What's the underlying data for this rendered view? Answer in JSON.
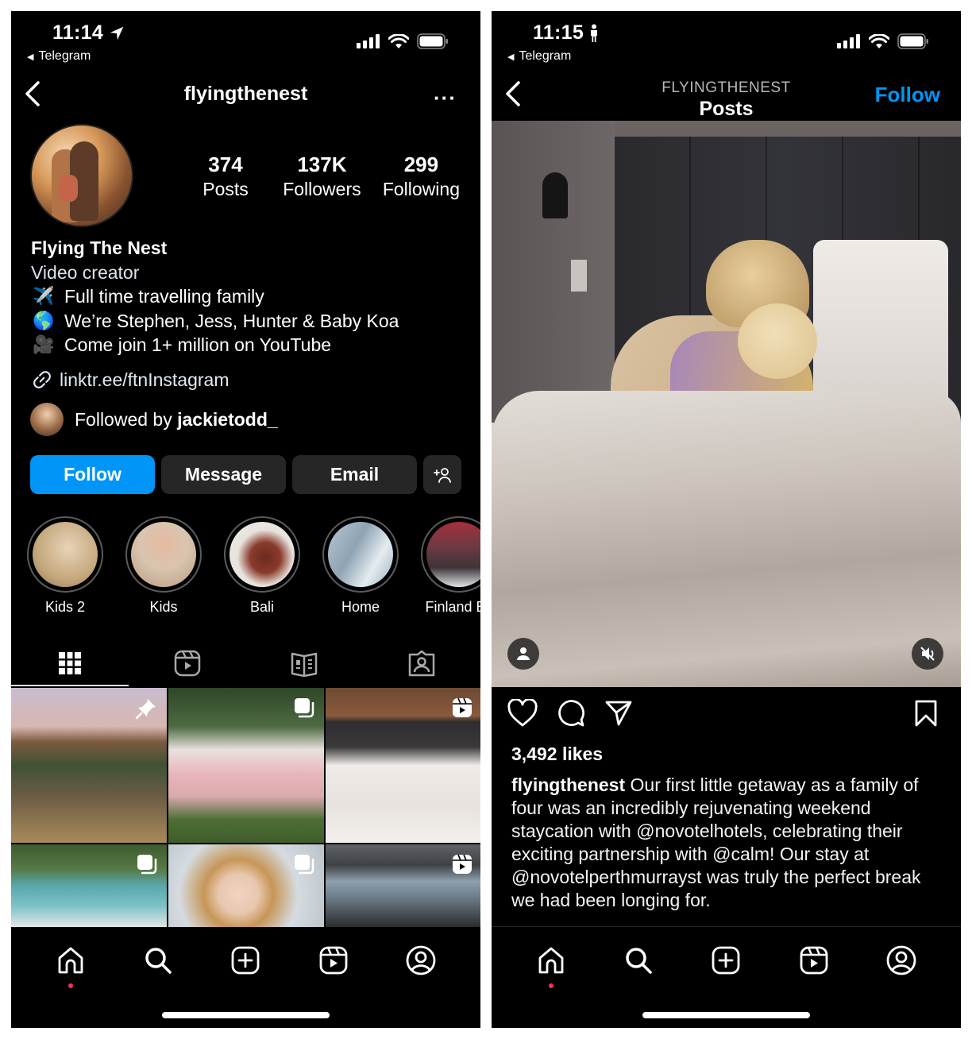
{
  "left": {
    "status": {
      "time": "11:14",
      "time_icon": "location-arrow-icon",
      "back_app": "Telegram"
    },
    "nav": {
      "title": "flyingthenest",
      "more": "···"
    },
    "profile": {
      "stats": [
        {
          "value": "374",
          "label": "Posts"
        },
        {
          "value": "137K",
          "label": "Followers"
        },
        {
          "value": "299",
          "label": "Following"
        }
      ],
      "name": "Flying The Nest",
      "category": "Video creator",
      "bio_lines": [
        {
          "emoji": "✈️",
          "icon": "airplane-emoji",
          "text": "Full time travelling family"
        },
        {
          "emoji": "🌎",
          "icon": "globe-emoji",
          "text": "We’re Stephen, Jess, Hunter & Baby Koa"
        },
        {
          "emoji": "🎥",
          "icon": "movie-camera-emoji",
          "text": "Come join 1+ million on YouTube"
        }
      ],
      "link": "linktr.ee/ftnInstagram",
      "followed_by_prefix": "Followed by ",
      "followed_by_user": "jackietodd_"
    },
    "buttons": {
      "follow": "Follow",
      "message": "Message",
      "email": "Email",
      "add_user_icon": "+👤"
    },
    "highlights": [
      {
        "label": "Kids 2",
        "color": "#cbb58f"
      },
      {
        "label": "Kids",
        "color": "#c9a98a"
      },
      {
        "label": "Bali",
        "color": "#8a3b2c"
      },
      {
        "label": "Home",
        "color": "#a9b8c4"
      },
      {
        "label": "Finland Ex",
        "color": "#8c4a55"
      }
    ],
    "tabs": [
      {
        "name": "grid",
        "active": true
      },
      {
        "name": "reels",
        "active": false
      },
      {
        "name": "guides",
        "active": false
      },
      {
        "name": "tagged",
        "active": false
      }
    ],
    "posts": [
      {
        "badge": "pin",
        "colors": [
          "#c9b9c8",
          "#6a5a45",
          "#8b7048"
        ]
      },
      {
        "badge": "carousel",
        "colors": [
          "#2f4a2a",
          "#e7b8b8",
          "#4f6a37"
        ]
      },
      {
        "badge": "reel",
        "colors": [
          "#7a4a30",
          "#efeae6",
          "#d8d3cf"
        ]
      },
      {
        "badge": "carousel",
        "colors": [
          "#4d6b3f",
          "#3f9da3",
          "#7fc0c5"
        ]
      },
      {
        "badge": "carousel",
        "colors": [
          "#d3d8de",
          "#c89a5a",
          "#ecd9c8"
        ]
      },
      {
        "badge": "reel",
        "colors": [
          "#3a3a3a",
          "#8a9aa8",
          "#2a2a2a"
        ]
      }
    ],
    "bottom_nav": [
      "home",
      "search",
      "create",
      "reels",
      "profile"
    ]
  },
  "right": {
    "status": {
      "time": "11:15",
      "time_icon": "person-walking-icon",
      "back_app": "Telegram"
    },
    "nav": {
      "subtitle": "FLYINGTHENEST",
      "title": "Posts",
      "follow": "Follow"
    },
    "post": {
      "likes": "3,492 likes",
      "author": "flyingthenest",
      "caption": " Our first little getaway as a family of four was an incredibly rejuvenating weekend staycation with @novotelhotels, celebrating their exciting partnership with @calm! Our stay at @novotelperthmurrayst was truly the perfect break we had been longing for."
    },
    "bottom_nav": [
      "home",
      "search",
      "create",
      "reels",
      "profile"
    ]
  },
  "colors": {
    "accent": "#0095f6",
    "notification_dot": "#ff2d55",
    "button_dark": "#262626"
  }
}
